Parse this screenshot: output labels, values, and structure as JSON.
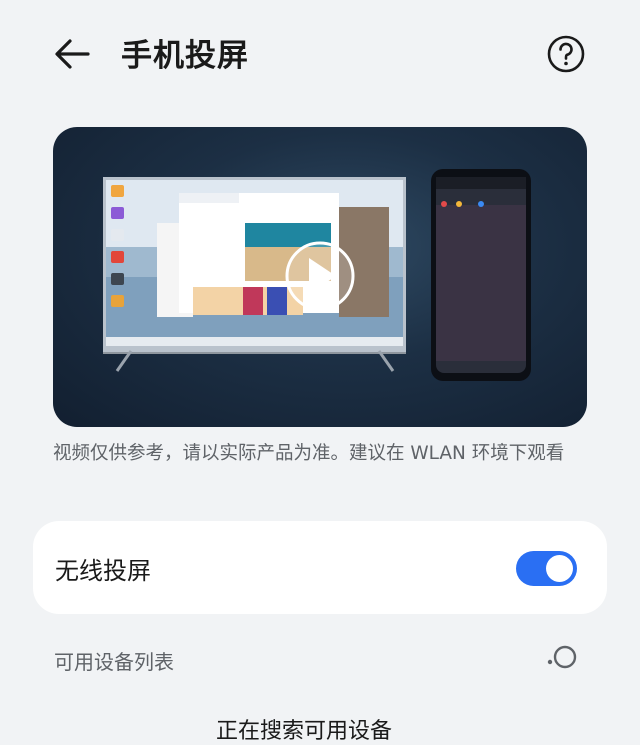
{
  "header": {
    "title": "手机投屏",
    "back_icon": "arrow-left-icon",
    "help_icon": "question-circle-icon"
  },
  "video": {
    "play_icon": "play-icon",
    "caption": "视频仅供参考，请以实际产品为准。建议在 WLAN 环境下观看"
  },
  "wireless": {
    "label": "无线投屏",
    "enabled": true,
    "accent": "#2a6ff3"
  },
  "devices": {
    "title": "可用设备列表",
    "status": "正在搜索可用设备",
    "spinner_icon": "loading-spinner-icon"
  }
}
